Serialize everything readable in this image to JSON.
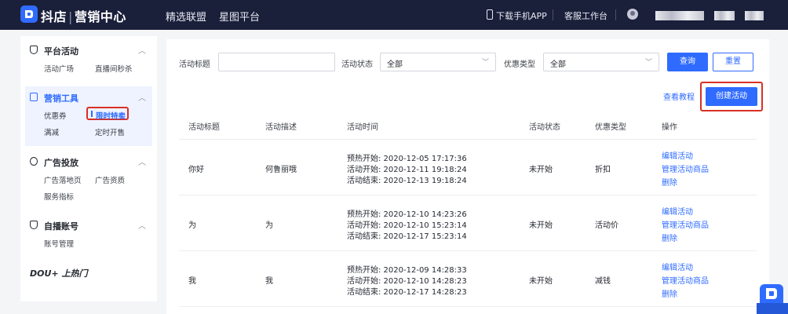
{
  "topbar": {
    "brand_name": "抖店",
    "brand_sep": "|",
    "brand_sub": "营销中心",
    "nav": [
      "精选联盟",
      "星图平台"
    ],
    "download_app": "下载手机APP",
    "customer_service": "客服工作台"
  },
  "sidebar": {
    "sections": [
      {
        "title": "平台活动",
        "icon": "shield-icon",
        "items": [
          "活动广场",
          "直播间秒杀"
        ]
      },
      {
        "title": "营销工具",
        "icon": "toolbox-icon",
        "items": [
          "优惠券",
          "限时特卖",
          "满减",
          "定时开售"
        ],
        "active_item": "限时特卖"
      },
      {
        "title": "广告投放",
        "icon": "target-icon",
        "items": [
          "广告落地页",
          "广告资质",
          "服务指标"
        ]
      },
      {
        "title": "自播账号",
        "icon": "shield-icon",
        "items": [
          "账号管理"
        ]
      }
    ],
    "dou_label": "DOU+ 上热门"
  },
  "filters": {
    "title_label": "活动标题",
    "title_value": "",
    "status_label": "活动状态",
    "status_value": "全部",
    "discount_label": "优惠类型",
    "discount_value": "全部",
    "search_button": "查询",
    "reset_button": "重置"
  },
  "actions": {
    "tutorial_link": "查看教程",
    "create_button": "创建活动"
  },
  "table": {
    "columns": [
      "活动标题",
      "活动描述",
      "活动时间",
      "活动状态",
      "优惠类型",
      "操作"
    ],
    "rows": [
      {
        "title": "你好",
        "desc": "何鲁丽哦",
        "preheat": "预热开始: 2020-12-05 17:17:36",
        "start": "活动开始: 2020-12-11 19:18:24",
        "end": "活动结束: 2020-12-13 19:18:24",
        "status": "未开始",
        "type": "折扣",
        "ops": [
          "编辑活动",
          "管理活动商品",
          "删除"
        ]
      },
      {
        "title": "为",
        "desc": "为",
        "preheat": "预热开始: 2020-12-10 14:23:26",
        "start": "活动开始: 2020-12-10 15:23:14",
        "end": "活动结束: 2020-12-17 15:23:14",
        "status": "未开始",
        "type": "活动价",
        "ops": [
          "编辑活动",
          "管理活动商品",
          "删除"
        ]
      },
      {
        "title": "我",
        "desc": "我",
        "preheat": "预热开始: 2020-12-09 14:28:33",
        "start": "活动开始: 2020-12-10 14:28:23",
        "end": "活动结束: 2020-12-17 14:28:23",
        "status": "未开始",
        "type": "减钱",
        "ops": [
          "编辑活动",
          "管理活动商品",
          "删除"
        ]
      }
    ]
  },
  "colors": {
    "topbar_bg": "#1a1f3a",
    "accent": "#2f6bff",
    "highlight_box": "#d93025"
  }
}
